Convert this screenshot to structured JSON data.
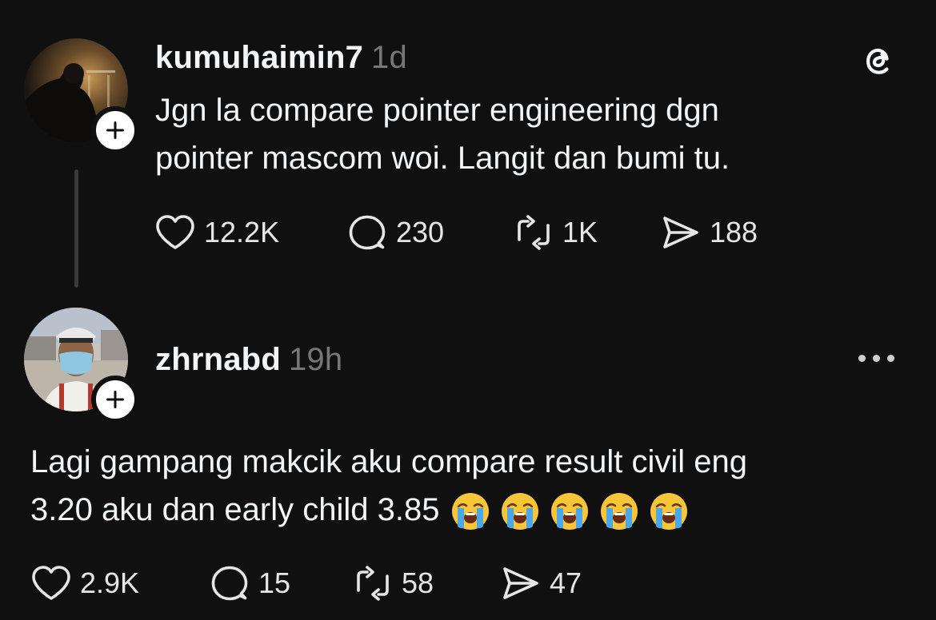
{
  "posts": [
    {
      "username": "kumuhaimin7",
      "time": "1d",
      "lines": [
        "Jgn la compare pointer engineering dgn",
        "pointer mascom woi. Langit dan bumi tu."
      ],
      "stats": {
        "likes": "12.2K",
        "replies": "230",
        "reposts": "1K",
        "shares": "188"
      }
    },
    {
      "username": "zhrnabd",
      "time": "19h",
      "lines": [
        "Lagi gampang makcik aku compare result civil eng",
        "3.20 aku dan early child 3.85"
      ],
      "emoji": [
        "loudly-crying-face",
        "loudly-crying-face",
        "loudly-crying-face",
        "loudly-crying-face",
        "loudly-crying-face"
      ],
      "stats": {
        "likes": "2.9K",
        "replies": "15",
        "reposts": "58",
        "shares": "47"
      }
    }
  ],
  "icons": {
    "app_logo": "threads-logo-icon",
    "like": "heart-icon",
    "reply": "speech-bubble-icon",
    "repost": "repost-icon",
    "share": "send-icon",
    "follow": "plus-icon",
    "more": "more-dots-icon"
  },
  "colors": {
    "background": "#101010",
    "text": "#f3f5f7",
    "muted": "#777777"
  }
}
